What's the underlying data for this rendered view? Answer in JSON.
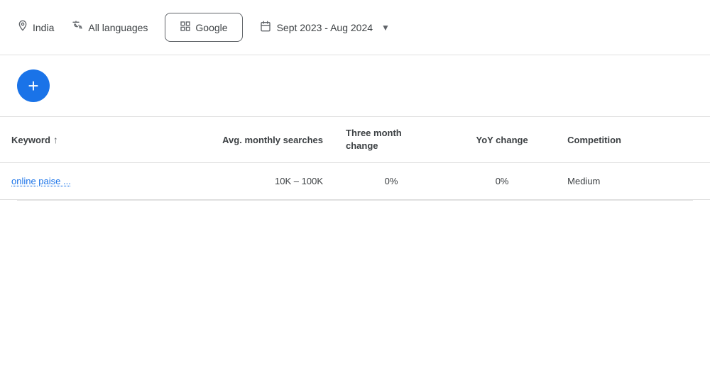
{
  "filters": {
    "location": {
      "label": "India",
      "icon": "location-pin"
    },
    "language": {
      "label": "All languages",
      "icon": "translate"
    },
    "search_engine": {
      "label": "Google",
      "icon": "grid"
    },
    "date_range": {
      "label": "Sept 2023 - Aug 2024",
      "icon": "calendar",
      "dropdown_arrow": "▼"
    }
  },
  "add_button": {
    "label": "+",
    "aria": "Add keyword"
  },
  "table": {
    "columns": [
      {
        "id": "keyword",
        "label": "Keyword",
        "sort": "↑"
      },
      {
        "id": "avg_monthly",
        "label": "Avg. monthly searches"
      },
      {
        "id": "three_month",
        "label": "Three month\nchange"
      },
      {
        "id": "yoy",
        "label": "YoY change"
      },
      {
        "id": "competition",
        "label": "Competition"
      },
      {
        "id": "overflow",
        "label": ""
      }
    ],
    "rows": [
      {
        "keyword": "online paise ...",
        "avg_monthly": "10K – 100K",
        "three_month": "0%",
        "yoy": "0%",
        "competition": "Medium"
      }
    ]
  }
}
